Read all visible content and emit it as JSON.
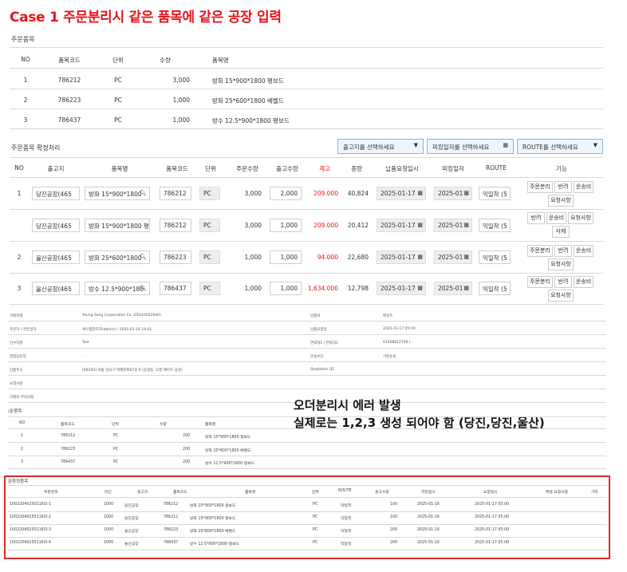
{
  "heading": "Case 1 주문분리시 같은 품목에 같은 공장 입력",
  "order_items": {
    "title": "주문품목",
    "headers": [
      "NO",
      "품목코드",
      "단위",
      "수량",
      "품목명"
    ],
    "rows": [
      [
        "1",
        "786212",
        "PC",
        "3,000",
        "방화 15*900*1800 평보드"
      ],
      [
        "2",
        "786223",
        "PC",
        "1,000",
        "방화 25*600*1800 베벨드"
      ],
      [
        "3",
        "786437",
        "PC",
        "1,000",
        "방수 12.5*900*1800 평보드"
      ]
    ]
  },
  "confirm": {
    "title": "주문품목 확정처리",
    "filters": {
      "warehouse": "출고지를 선택하세요",
      "picking_date": "피킹일자를 선택하세요",
      "route": "ROUTE를 선택하세요"
    },
    "headers": [
      "NO",
      "출고지",
      "품목명",
      "품목코드",
      "단위",
      "주문수량",
      "출고수량",
      "재고",
      "중량",
      "납품요청일시",
      "피킹일자",
      "ROUTE",
      "기능"
    ],
    "rows": [
      {
        "no": "1",
        "warehouse": "당진공장(465",
        "item": "방화 15*900*1800",
        "code": "786212",
        "unit": "PC",
        "order_qty": "3,000",
        "ship_qty": "2,000",
        "stock": "209.000",
        "weight": "40,824",
        "delivery": "2025-01-17",
        "picking": "2025-01",
        "route": "익일착 (5",
        "actions": [
          "주문분리",
          "반려",
          "운송비",
          "요청사항"
        ]
      },
      {
        "no": "",
        "warehouse": "당진공장(465",
        "item": "방화 15*900*1800 평",
        "code": "786212",
        "unit": "PC",
        "order_qty": "3,000",
        "ship_qty": "1,000",
        "stock": "209.000",
        "weight": "20,412",
        "delivery": "2025-01-17",
        "picking": "2025-01",
        "route": "익일착 (5",
        "actions": [
          "반려",
          "운송비",
          "요청사항",
          "삭제"
        ]
      },
      {
        "no": "2",
        "warehouse": "울산공장(465",
        "item": "방화 25*600*1800",
        "code": "786223",
        "unit": "PC",
        "order_qty": "1,000",
        "ship_qty": "1,000",
        "stock": "94.000",
        "weight": "22,680",
        "delivery": "2025-01-17",
        "picking": "2025-01",
        "route": "익일착 (5",
        "actions": [
          "주문분리",
          "반려",
          "운송비",
          "요청사항"
        ]
      },
      {
        "no": "3",
        "warehouse": "울산공장(465",
        "item": "방수 12.5*900*180",
        "code": "786437",
        "unit": "PC",
        "order_qty": "1,000",
        "ship_qty": "1,000",
        "stock": "1,634.000",
        "weight": "12,798",
        "delivery": "2025-01-17",
        "picking": "2025-01",
        "route": "익일착 (5",
        "actions": [
          "주문분리",
          "반려",
          "운송비",
          "요청사항"
        ]
      }
    ]
  },
  "info": {
    "left": [
      [
        "거래처명",
        "Young Sang Corporation Co. LTD(10022040)"
      ],
      [
        "주문자 / 주문일자",
        "써스템관리자(admin) / 2025-01-16 14:41"
      ],
      [
        "인수자명",
        "Test"
      ],
      [
        "영업담당자",
        "-"
      ],
      [
        "납품주소",
        "[06169] 서울 강남구 테헤란로87길 9 (삼성동, 오병 페어즈 삼성)"
      ],
      [
        "요청사항",
        ""
      ],
      [
        "거래처 주의사항",
        ""
      ]
    ],
    "right": [
      [
        "납품처",
        "메릿츠"
      ],
      [
        "납품요청일",
        "2025-01-17 05:00"
      ],
      [
        "연락처1 / 연락처2",
        "01068012700 / -"
      ],
      [
        "운송수단",
        "기본운송"
      ],
      [
        "Quotation Q1",
        ""
      ]
    ]
  },
  "note": {
    "line1": "오더분리시 에러 발생",
    "line2": "실제로는 1,2,3 생성 되어야 함 (당진,당진,울산)"
  },
  "order_items2": {
    "title": "(문품목",
    "headers": [
      "NO",
      "품목코드",
      "단위",
      "수량",
      "품목명"
    ],
    "rows": [
      [
        "1",
        "786212",
        "PC",
        "200",
        "방화 15*900*1800 평보드"
      ],
      [
        "2",
        "786223",
        "PC",
        "200",
        "방화 25*600*1800 베벨드"
      ],
      [
        "3",
        "786437",
        "PC",
        "200",
        "방수 12.5*900*1800 평보드"
      ]
    ]
  },
  "confirmed": {
    "title": "문확정품목",
    "headers": [
      "주문번호",
      "라인",
      "출고지",
      "품목코드",
      "품목명",
      "단위",
      "ROUTE",
      "출고수량",
      "피킹일시",
      "요청일시",
      "확정 요청사항",
      "기타"
    ],
    "rows": [
      [
        "10022040250116l3-1",
        "1000",
        "당진공장",
        "786212",
        "방화 15*900*1800 평보드",
        "PC",
        "익일착",
        "100",
        "2025-01-16",
        "2025-01-17 05:00",
        "",
        ""
      ],
      [
        "10022040250116l3-2",
        "1000",
        "당진공장",
        "786212",
        "방화 15*900*1800 평보드",
        "PC",
        "익일착",
        "100",
        "2025-01-16",
        "2025-01-17 05:00",
        "",
        ""
      ],
      [
        "10022040250116l3-3",
        "1000",
        "울산공장",
        "786223",
        "방화 25*600*1800 베벨드",
        "PC",
        "익일착",
        "200",
        "2025-01-16",
        "2025-01-17 05:00",
        "",
        ""
      ],
      [
        "10022040250116l3-4",
        "1000",
        "울산공장",
        "786437",
        "방수 12.5*900*1800 평보드",
        "PC",
        "익일착",
        "200",
        "2025-01-16",
        "2025-01-17 05:00",
        "",
        ""
      ]
    ]
  }
}
